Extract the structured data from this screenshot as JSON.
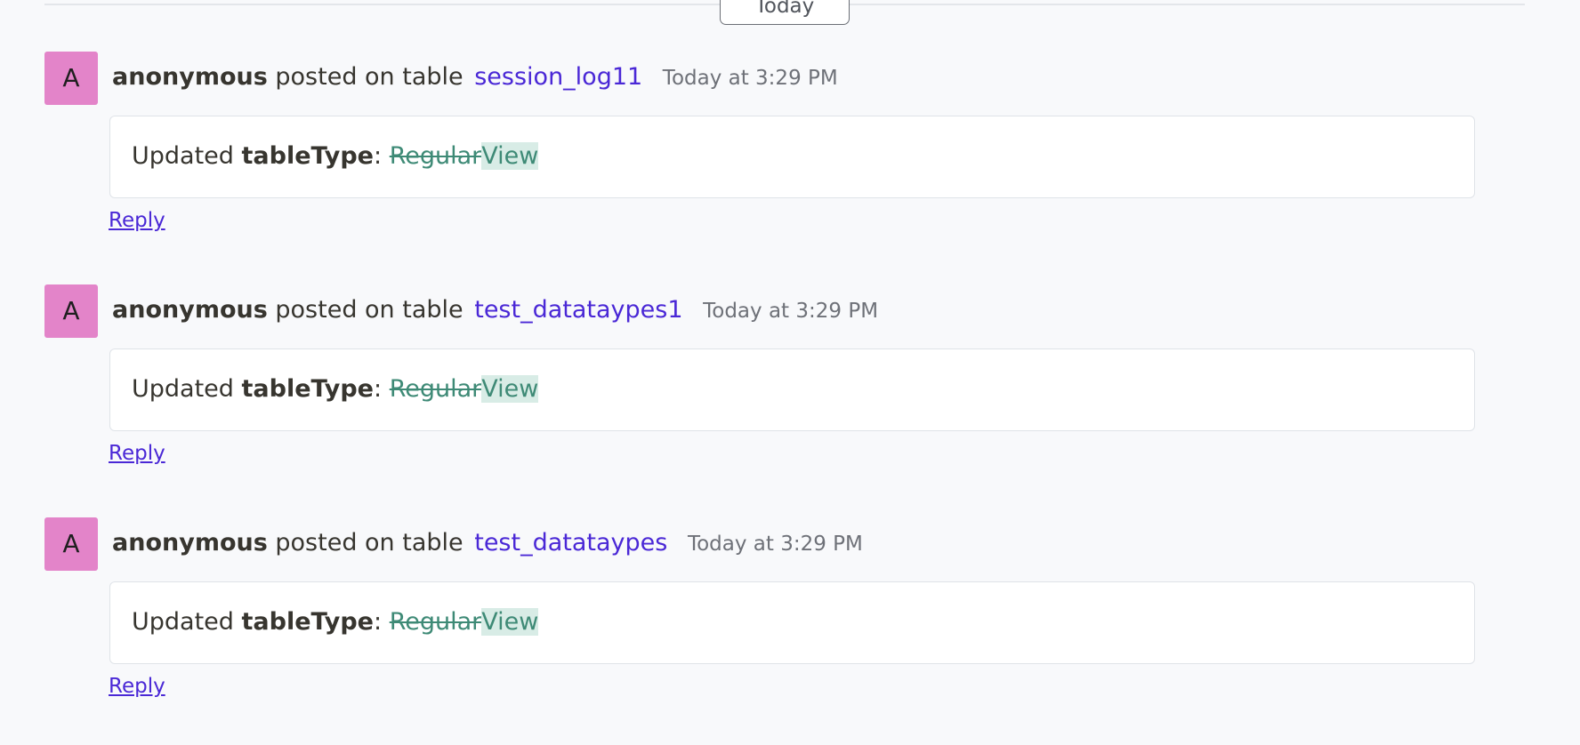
{
  "divider": {
    "day_label": "Today"
  },
  "entries": [
    {
      "avatar_letter": "A",
      "author": "anonymous",
      "action": "posted on table",
      "table": "session_log11",
      "timestamp": "Today at 3:29 PM",
      "update_prefix": "Updated",
      "field": "tableType",
      "separator": ":",
      "old_value": "Regular",
      "new_value": "View",
      "reply_label": "Reply"
    },
    {
      "avatar_letter": "A",
      "author": "anonymous",
      "action": "posted on table",
      "table": "test_datataypes1",
      "timestamp": "Today at 3:29 PM",
      "update_prefix": "Updated",
      "field": "tableType",
      "separator": ":",
      "old_value": "Regular",
      "new_value": "View",
      "reply_label": "Reply"
    },
    {
      "avatar_letter": "A",
      "author": "anonymous",
      "action": "posted on table",
      "table": "test_datataypes",
      "timestamp": "Today at 3:29 PM",
      "update_prefix": "Updated",
      "field": "tableType",
      "separator": ":",
      "old_value": "Regular",
      "new_value": "View",
      "reply_label": "Reply"
    }
  ],
  "colors": {
    "avatar_bg": "#e384c9",
    "link": "#4a28d6",
    "diff_text": "#3e8a76",
    "diff_added_bg": "#d8ece6",
    "page_bg": "#f8f9fb"
  }
}
